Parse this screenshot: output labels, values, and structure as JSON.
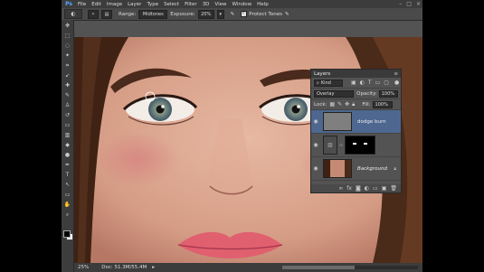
{
  "menubar": {
    "logo": "Ps",
    "items": [
      "File",
      "Edit",
      "Image",
      "Layer",
      "Type",
      "Select",
      "Filter",
      "3D",
      "View",
      "Window",
      "Help"
    ]
  },
  "options": {
    "range_label": "Range:",
    "range_value": "Midtones",
    "exposure_label": "Exposure:",
    "exposure_value": "20%",
    "protect_tones_label": "Protect Tones"
  },
  "status": {
    "zoom": "25%",
    "doc": "Doc: 51.3M/55.4M"
  },
  "layers_panel": {
    "title": "Layers",
    "filter_value": "Kind",
    "blend_mode": "Overlay",
    "opacity_label": "Opacity:",
    "opacity_value": "100%",
    "lock_label": "Lock:",
    "fill_label": "Fill:",
    "fill_value": "100%",
    "layers": [
      {
        "name": "dodge burn",
        "selected": true
      },
      {
        "name": "",
        "selected": false
      },
      {
        "name": "Background",
        "selected": false
      }
    ]
  },
  "colors": {
    "app_bg": "#535353",
    "selected_layer": "#4d6790",
    "skin": "#d9a38c"
  }
}
